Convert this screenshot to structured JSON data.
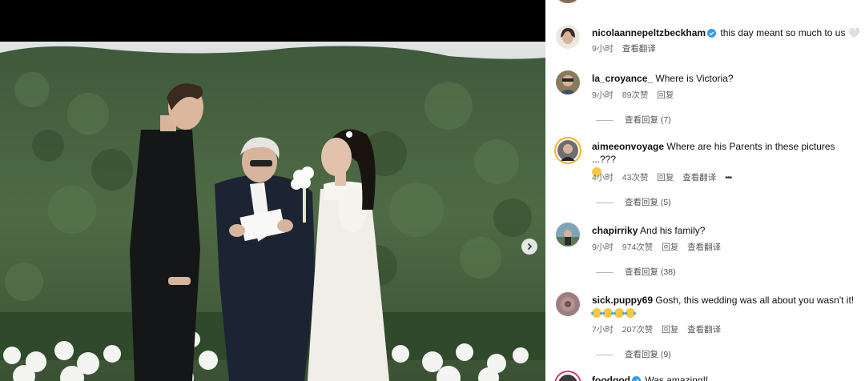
{
  "post": {
    "comments": [
      {
        "username": "nicolaannepeltzbeckham",
        "verified": true,
        "text": "this day meant so much to us",
        "heart": "🤍",
        "time": "9小时",
        "translate": "查看翻译"
      },
      {
        "username": "la_croyance_",
        "text": "Where is Victoria?",
        "time": "9小时",
        "likes": "89次赞",
        "reply": "回复",
        "view_replies": "查看回复 (7)"
      },
      {
        "username": "aimeeonvoyage",
        "text": "Where are his Parents in these pictures ...???",
        "time": "4小时",
        "likes": "43次赞",
        "reply": "回复",
        "translate": "查看翻译",
        "more": "•••",
        "view_replies": "查看回复 (5)"
      },
      {
        "username": "chapirriky",
        "text": "And his family?",
        "time": "9小时",
        "likes": "974次赞",
        "reply": "回复",
        "translate": "查看翻译",
        "view_replies": "查看回复 (38)"
      },
      {
        "username": "sick.puppy69",
        "text": "Gosh, this wedding was all about you wasn't it!",
        "time": "7小时",
        "likes": "207次赞",
        "reply": "回复",
        "translate": "查看翻译",
        "view_replies": "查看回复 (9)"
      },
      {
        "username": "foodgod",
        "verified": true,
        "text": "Was amazing!!"
      }
    ]
  },
  "colors": {
    "verified": "#3897f0",
    "accent_ring": "#e1306c"
  }
}
